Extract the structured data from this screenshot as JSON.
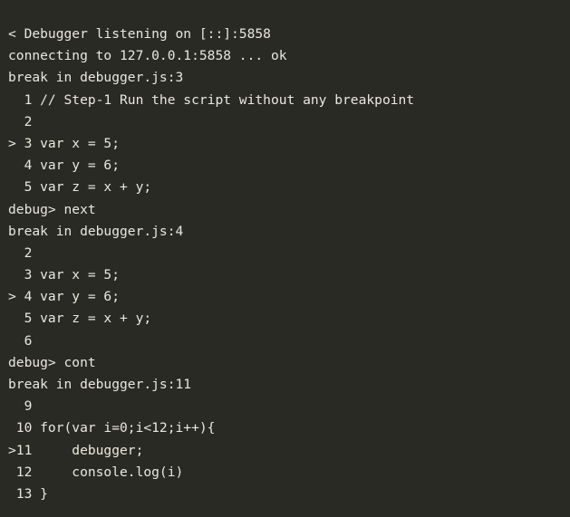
{
  "terminal": {
    "app": "node-inspect-debugger",
    "colors": {
      "background": "#2a2a24",
      "foreground": "#e8e8e0",
      "current_line_marker": "#eaeade"
    },
    "script_name": "debugger.js",
    "debugger_host": "127.0.0.1",
    "debugger_port": "5858",
    "prompt": "debug>",
    "current_line_marker": ">",
    "commands_issued": [
      "next",
      "cont"
    ],
    "breakpoints_hit": [
      "debugger.js:3",
      "debugger.js:4",
      "debugger.js:11"
    ],
    "lines": [
      {
        "id": "l01",
        "text": "< Debugger listening on [::]:5858",
        "kind": "debugger-output",
        "current": false
      },
      {
        "id": "l02",
        "text": "connecting to 127.0.0.1:5858 ... ok",
        "kind": "debugger-output",
        "current": false
      },
      {
        "id": "l03",
        "text": "break in debugger.js:3",
        "kind": "break-notice",
        "current": false
      },
      {
        "id": "l04",
        "text": "  1 // Step-1 Run the script without any breakpoint",
        "kind": "source-line",
        "current": false
      },
      {
        "id": "l05",
        "text": "  2",
        "kind": "source-line",
        "current": false
      },
      {
        "id": "l06",
        "text": "> 3 var x = 5;",
        "kind": "source-line",
        "current": true
      },
      {
        "id": "l07",
        "text": "  4 var y = 6;",
        "kind": "source-line",
        "current": false
      },
      {
        "id": "l08",
        "text": "  5 var z = x + y;",
        "kind": "source-line",
        "current": false
      },
      {
        "id": "l09",
        "text": "debug> next",
        "kind": "prompt-command",
        "current": false
      },
      {
        "id": "l10",
        "text": "break in debugger.js:4",
        "kind": "break-notice",
        "current": false
      },
      {
        "id": "l11",
        "text": "  2",
        "kind": "source-line",
        "current": false
      },
      {
        "id": "l12",
        "text": "  3 var x = 5;",
        "kind": "source-line",
        "current": false
      },
      {
        "id": "l13",
        "text": "> 4 var y = 6;",
        "kind": "source-line",
        "current": true
      },
      {
        "id": "l14",
        "text": "  5 var z = x + y;",
        "kind": "source-line",
        "current": false
      },
      {
        "id": "l15",
        "text": "  6",
        "kind": "source-line",
        "current": false
      },
      {
        "id": "l16",
        "text": "debug> cont",
        "kind": "prompt-command",
        "current": false
      },
      {
        "id": "l17",
        "text": "break in debugger.js:11",
        "kind": "break-notice",
        "current": false
      },
      {
        "id": "l18",
        "text": "  9",
        "kind": "source-line",
        "current": false
      },
      {
        "id": "l19",
        "text": " 10 for(var i=0;i<12;i++){",
        "kind": "source-line",
        "current": false
      },
      {
        "id": "l20",
        "text": ">11     debugger;",
        "kind": "source-line",
        "current": true
      },
      {
        "id": "l21",
        "text": " 12     console.log(i)",
        "kind": "source-line",
        "current": false
      },
      {
        "id": "l22",
        "text": " 13 }",
        "kind": "source-line",
        "current": false
      }
    ]
  }
}
